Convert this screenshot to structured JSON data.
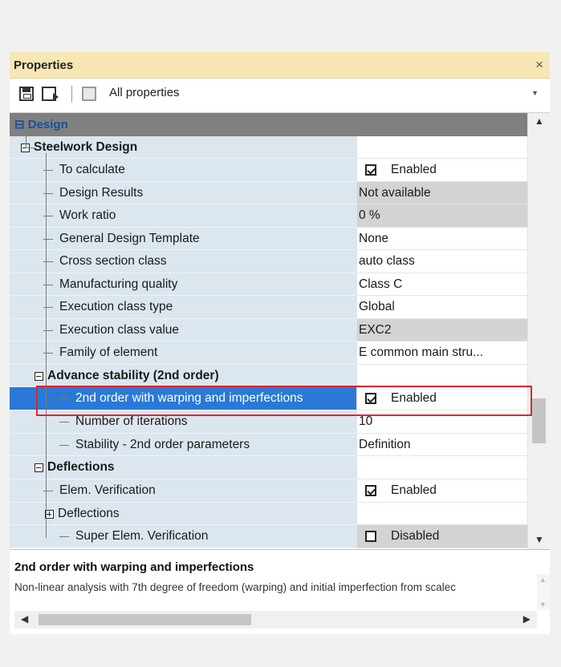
{
  "panel": {
    "title": "Properties",
    "close_glyph": "×"
  },
  "toolbar": {
    "icons": [
      "save-icon",
      "load-icon",
      "filter-icon"
    ],
    "filter_value": "All properties"
  },
  "category": {
    "label": "Design",
    "glyph": "⊟"
  },
  "rows": [
    {
      "label": "Steelwork Design",
      "value": "",
      "checkbox": null,
      "bold": true,
      "readonly": false
    },
    {
      "label": "To calculate",
      "value": "Enabled",
      "checkbox": true,
      "bold": false,
      "readonly": false
    },
    {
      "label": "Design Results",
      "value": "Not available",
      "checkbox": null,
      "bold": false,
      "readonly": true
    },
    {
      "label": "Work ratio",
      "value": "0 %",
      "checkbox": null,
      "bold": false,
      "readonly": true
    },
    {
      "label": "General Design Template",
      "value": "None",
      "checkbox": null,
      "bold": false,
      "readonly": false
    },
    {
      "label": "Cross section class",
      "value": "auto class",
      "checkbox": null,
      "bold": false,
      "readonly": false
    },
    {
      "label": "Manufacturing quality",
      "value": "Class C",
      "checkbox": null,
      "bold": false,
      "readonly": false
    },
    {
      "label": "Execution class type",
      "value": "Global",
      "checkbox": null,
      "bold": false,
      "readonly": false
    },
    {
      "label": "Execution class value",
      "value": "EXC2",
      "checkbox": null,
      "bold": false,
      "readonly": true
    },
    {
      "label": "Family of element",
      "value": "E common main stru...",
      "checkbox": null,
      "bold": false,
      "readonly": false
    },
    {
      "label": "Advance stability (2nd order)",
      "value": "",
      "checkbox": null,
      "bold": true,
      "readonly": false
    },
    {
      "label": "2nd order with warping and imperfections",
      "value": "Enabled",
      "checkbox": true,
      "bold": false,
      "readonly": false,
      "selected": true
    },
    {
      "label": "Number of iterations",
      "value": "10",
      "checkbox": null,
      "bold": false,
      "readonly": false
    },
    {
      "label": "Stability - 2nd order parameters",
      "value": "Definition",
      "checkbox": null,
      "bold": false,
      "readonly": false
    },
    {
      "label": "Deflections",
      "value": "",
      "checkbox": null,
      "bold": true,
      "readonly": false
    },
    {
      "label": "Elem. Verification",
      "value": "Enabled",
      "checkbox": true,
      "bold": false,
      "readonly": false
    },
    {
      "label": "Deflections",
      "value": "",
      "checkbox": null,
      "bold": false,
      "readonly": false
    },
    {
      "label": "Super Elem. Verification",
      "value": "Disabled",
      "checkbox": false,
      "bold": false,
      "readonly": true
    }
  ],
  "description": {
    "title": "2nd order with warping and imperfections",
    "body": "Non-linear analysis with 7th degree of freedom (warping) and initial imperfection from scalec"
  },
  "colors": {
    "selection": "#2a79d6",
    "highlight_box": "#e1242c",
    "title_bar": "#f6e7b4",
    "category_text": "#1b4f9c"
  }
}
